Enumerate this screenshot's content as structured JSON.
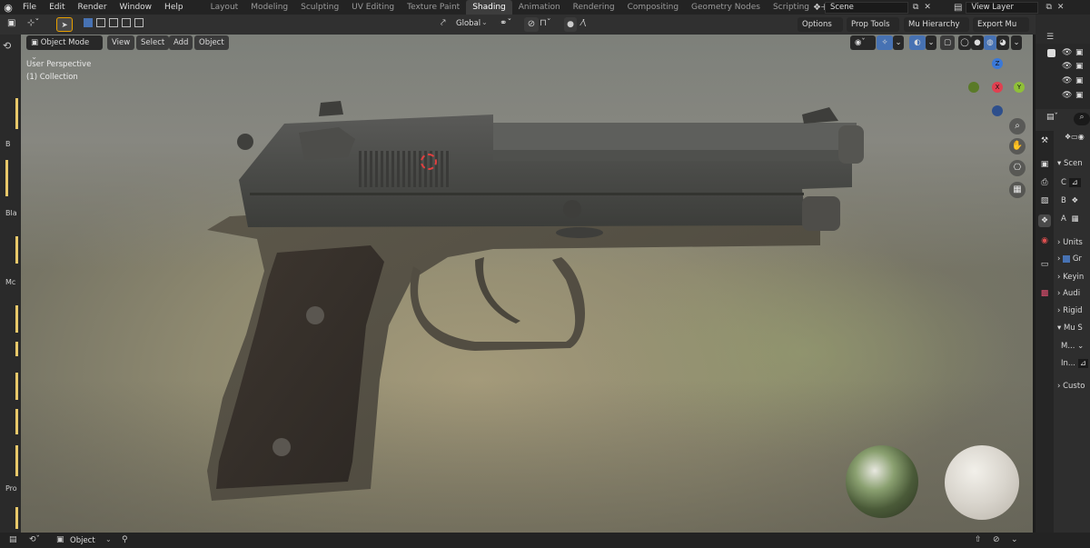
{
  "top_menu": {
    "items": [
      "File",
      "Edit",
      "Render",
      "Window",
      "Help"
    ],
    "workspaces": [
      "Layout",
      "Modeling",
      "Sculpting",
      "UV Editing",
      "Texture Paint",
      "Shading",
      "Animation",
      "Rendering",
      "Compositing",
      "Geometry Nodes",
      "Scripting"
    ],
    "active_workspace": "Shading",
    "add_symbol": "+",
    "scene": "Scene",
    "view_layer": "View Layer"
  },
  "header": {
    "transform_orientation": "Global",
    "options": "Options",
    "prop_tools": "Prop Tools",
    "mu_hierarchy": "Mu Hierarchy",
    "export_mu": "Export Mu"
  },
  "viewport_header": {
    "mode": "Object Mode",
    "menus": [
      "View",
      "Select",
      "Add",
      "Object"
    ]
  },
  "viewport": {
    "perspective": "User Perspective",
    "collection": "(1) Collection",
    "axes": {
      "z": "Z",
      "x": "X",
      "y": "Y"
    }
  },
  "left_strip_labels": [
    "B",
    "Bla",
    "Mc",
    "Pro"
  ],
  "properties": {
    "scene_label": "Scen",
    "rows": [
      "C",
      "B",
      "A"
    ],
    "sections": [
      "Units",
      "Gr",
      "Keyin",
      "Audi",
      "Rigid",
      "Mu S",
      "M...",
      "In...",
      "Custo"
    ]
  },
  "bottom_bar": {
    "object_label": "Object"
  },
  "colors": {
    "active_tab": "#3d3d3d",
    "accent_blue": "#4772b3",
    "axis_x": "#e04050",
    "axis_y": "#8fc038",
    "axis_z": "#3a78d8",
    "highlight_bar": "#e8c86a"
  }
}
